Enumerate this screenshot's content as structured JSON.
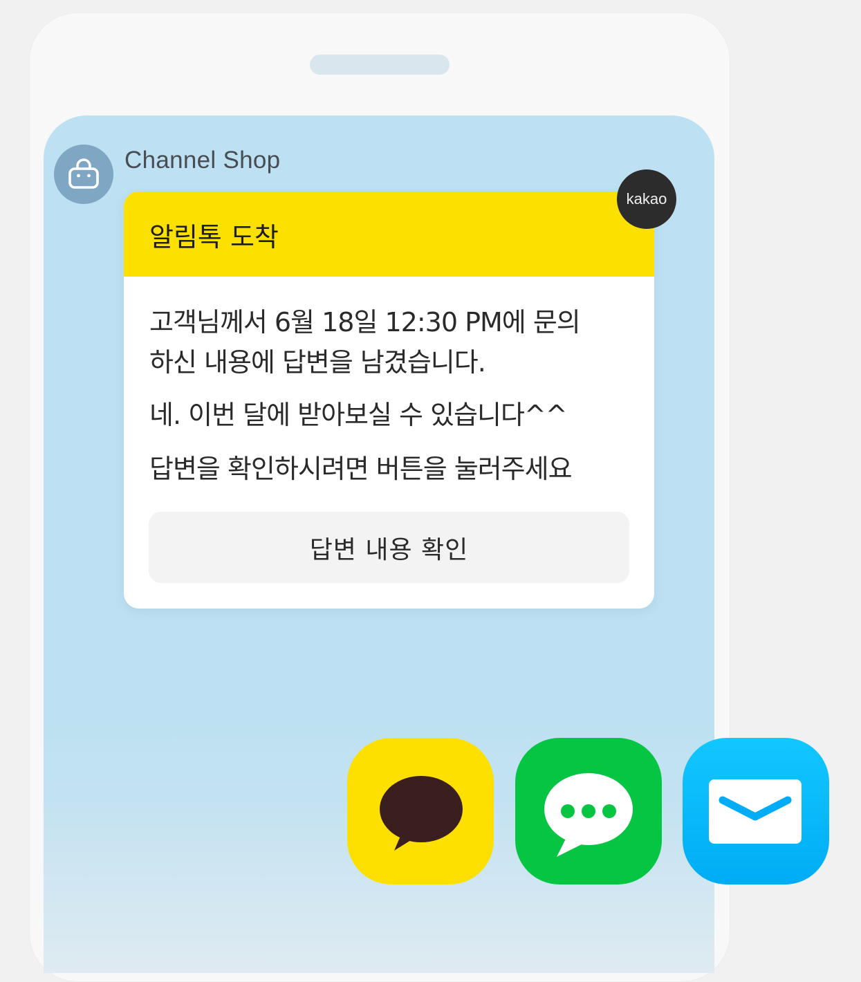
{
  "channel": {
    "name": "Channel Shop",
    "avatar_icon": "shopping-bag-icon"
  },
  "card": {
    "header_title": "알림톡 도착",
    "badge_label": "kakao",
    "message_lines": [
      "고객님께서 6월 18일 12:30 PM에 문의",
      "하신 내용에 답변을 남겼습니다.",
      "네. 이번 달에 받아보실 수 있습니다^^",
      "답변을 확인하시려면 버튼을 눌러주세요"
    ],
    "button_label": "답변 내용 확인"
  },
  "apps": [
    {
      "name": "kakaotalk-icon",
      "color": "#fee000"
    },
    {
      "name": "message-icon",
      "color": "#06c543"
    },
    {
      "name": "mail-icon",
      "color": "#12c7ff"
    }
  ],
  "colors": {
    "header_yellow": "#fce000",
    "screen_blue": "#bde1f2",
    "avatar_blue": "#7fa6c2",
    "badge_dark": "#2c2c2c"
  }
}
